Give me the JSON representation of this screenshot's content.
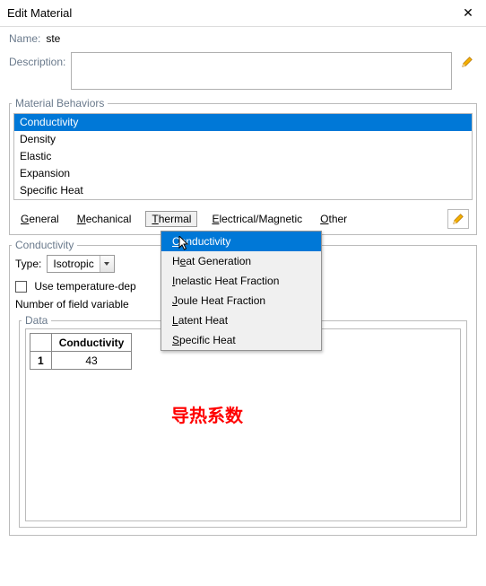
{
  "window": {
    "title": "Edit Material"
  },
  "name": {
    "label": "Name:",
    "value": "ste"
  },
  "description": {
    "label": "Description:",
    "value": ""
  },
  "behaviors": {
    "legend": "Material Behaviors",
    "items": [
      "Conductivity",
      "Density",
      "Elastic",
      "Expansion",
      "Specific Heat"
    ],
    "selected_index": 0
  },
  "menubar": {
    "items": [
      {
        "ul": "G",
        "rest": "eneral"
      },
      {
        "ul": "M",
        "rest": "echanical"
      },
      {
        "ul": "T",
        "rest": "hermal"
      },
      {
        "ul": "E",
        "rest": "lectrical/Magnetic"
      },
      {
        "ul": "O",
        "rest": "ther"
      }
    ],
    "active_index": 2
  },
  "thermal_menu": {
    "items": [
      {
        "ul": "C",
        "rest": "onductivity"
      },
      {
        "pre": "H",
        "ul": "e",
        "rest": "at Generation"
      },
      {
        "ul": "I",
        "rest": "nelastic Heat Fraction"
      },
      {
        "ul": "J",
        "rest": "oule Heat Fraction"
      },
      {
        "ul": "L",
        "rest": "atent Heat"
      },
      {
        "ul": "S",
        "rest": "pecific Heat"
      }
    ],
    "highlight_index": 0
  },
  "conductivity": {
    "title": "Conductivity",
    "type_label": "Type:",
    "type_value": "Isotropic",
    "temp_dep_label": "Use temperature-dep",
    "field_vars_label": "Number of field variable"
  },
  "data": {
    "legend": "Data",
    "header": "Conductivity",
    "row_index": "1",
    "value": "43"
  },
  "annotation": "导热系数"
}
